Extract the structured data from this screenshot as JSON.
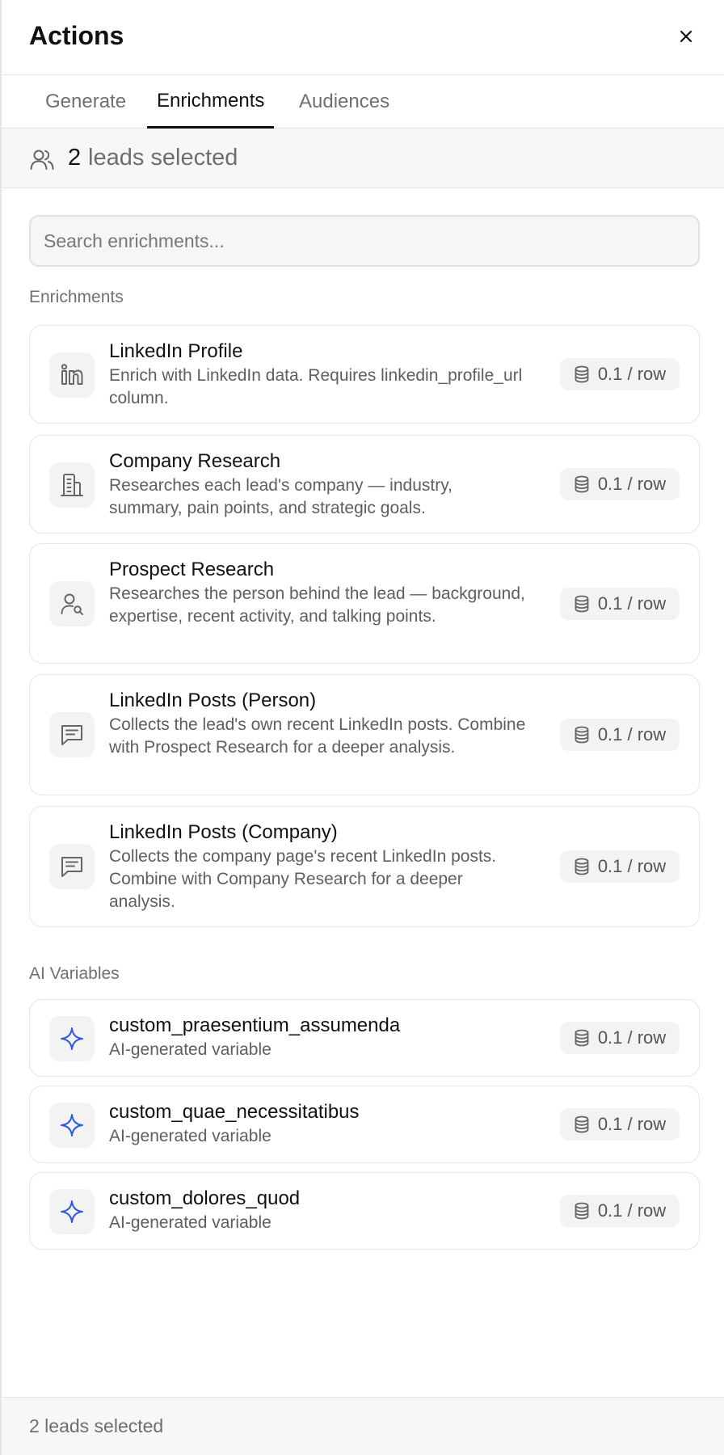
{
  "panel": {
    "title": "Actions",
    "close_icon": "close-icon"
  },
  "tabs": [
    {
      "label": "Generate",
      "active": false
    },
    {
      "label": "Enrichments",
      "active": true
    },
    {
      "label": "Audiences",
      "active": false
    }
  ],
  "selection": {
    "count": "2",
    "text": "leads selected",
    "icon": "users-icon"
  },
  "search": {
    "placeholder": "Search enrichments..."
  },
  "sections": {
    "enrichments_label": "Enrichments",
    "ai_variables_label": "AI Variables"
  },
  "enrichments": [
    {
      "icon": "linkedin-icon",
      "title": "LinkedIn Profile",
      "description": "Enrich with LinkedIn data. Requires linkedin_profile_url column.",
      "cost": "0.1 / row"
    },
    {
      "icon": "building-icon",
      "title": "Company Research",
      "description": "Researches each lead's company — industry, summary, pain points, and strategic goals.",
      "cost": "0.1 / row"
    },
    {
      "icon": "user-search-icon",
      "title": "Prospect Research",
      "description": "Researches the person behind the lead — background, expertise, recent activity, and talking points.",
      "cost": "0.1 / row"
    },
    {
      "icon": "message-icon",
      "title": "LinkedIn Posts (Person)",
      "description": "Collects the lead's own recent LinkedIn posts. Combine with Prospect Research for a deeper analysis.",
      "cost": "0.1 / row"
    },
    {
      "icon": "message-icon",
      "title": "LinkedIn Posts (Company)",
      "description": "Collects the company page's recent LinkedIn posts. Combine with Company Research for a deeper analysis.",
      "cost": "0.1 / row"
    }
  ],
  "ai_variables": [
    {
      "icon": "sparkle-icon",
      "title": "custom_praesentium_assumenda",
      "description": "AI-generated variable",
      "cost": "0.1 / row"
    },
    {
      "icon": "sparkle-icon",
      "title": "custom_quae_necessitatibus",
      "description": "AI-generated variable",
      "cost": "0.1 / row"
    },
    {
      "icon": "sparkle-icon",
      "title": "custom_dolores_quod",
      "description": "AI-generated variable",
      "cost": "0.1 / row"
    }
  ],
  "footer": {
    "text": "2 leads selected"
  },
  "colors": {
    "accent_blue": "#2f5bd6",
    "border": "#e4e4e4",
    "muted_text": "#6e6e6e"
  }
}
